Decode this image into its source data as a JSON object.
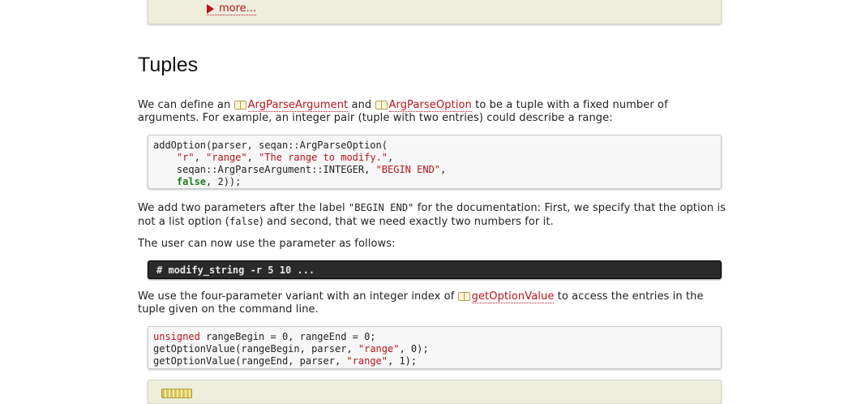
{
  "top_box": {
    "more_label": "more..."
  },
  "section": {
    "title": "Tuples"
  },
  "para1": {
    "before": "We can define an ",
    "link1": "ArgParseArgument",
    "mid": " and ",
    "link2": "ArgParseOption",
    "after": " to be a tuple with a fixed number of arguments. For example, an integer pair (tuple with two entries) could describe a range:"
  },
  "code1": {
    "line1": "addOption(parser, seqan::ArgParseOption(",
    "line2_s1": "\"r\"",
    "line2_s2": "\"range\"",
    "line2_s3": "\"The range to modify.\"",
    "line3_a": "seqan::ArgParseArgument::INTEGER, ",
    "line3_s": "\"BEGIN END\"",
    "line4_kw": "false",
    "line4_rest": ", 2));"
  },
  "para2": {
    "before": "We add two parameters after the label ",
    "code1": "\"BEGIN END\"",
    "mid": " for the documentation: First, we specify that the option is not a list option (",
    "code2": "false",
    "after": ") and second, that we need exactly two numbers for it."
  },
  "para3": {
    "text": "The user can now use the parameter as follows:"
  },
  "shell": {
    "command": "# modify_string -r 5 10 ..."
  },
  "para4": {
    "before": "We use the four-parameter variant with an integer index of ",
    "link": "getOptionValue",
    "after": " to access the entries in the tuple given on the command line."
  },
  "code2": {
    "l1_kw": "unsigned",
    "l1_rest": " rangeBegin = 0, rangeEnd = 0;",
    "l2_a": "getOptionValue(rangeBegin, parser, ",
    "l2_s": "\"range\"",
    "l2_b": ", 0);",
    "l3_a": "getOptionValue(rangeEnd, parser, ",
    "l3_s": "\"range\"",
    "l3_b": ", 1);"
  },
  "icons": {
    "doc_link_icon": "book-icon",
    "expand_icon": "triangle-right-icon",
    "bottom_icon": "pencil-icon"
  }
}
